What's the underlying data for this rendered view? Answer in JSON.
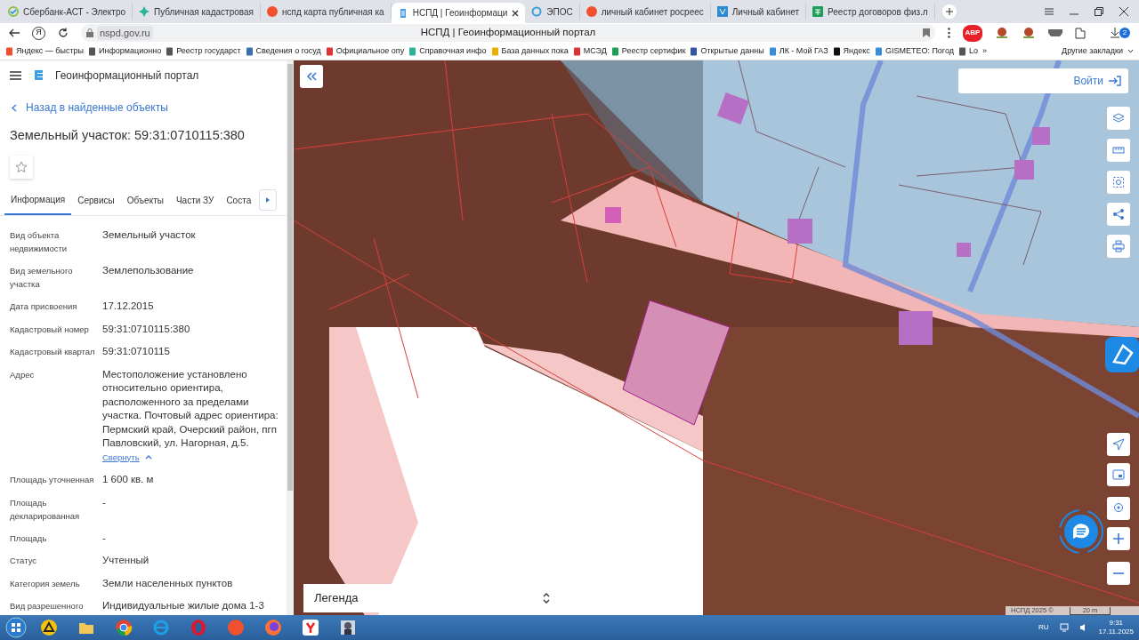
{
  "browser": {
    "tabs": [
      {
        "title": "Сбербанк-АСТ - Электро",
        "selected": false
      },
      {
        "title": "Публичная кадастровая",
        "selected": false
      },
      {
        "title": "нспд карта публичная ка",
        "selected": false
      },
      {
        "title": "НСПД | Геоинформаци",
        "selected": true
      },
      {
        "title": "ЭПОС",
        "selected": false
      },
      {
        "title": "личный кабинет росреес",
        "selected": false
      },
      {
        "title": "Личный кабинет",
        "selected": false
      },
      {
        "title": "Реестр договоров физ.л",
        "selected": false
      }
    ],
    "home_label": "Я",
    "address": "nspd.gov.ru",
    "page_title": "НСПД | Геоинформационный портал",
    "adblock_label": "ABP",
    "downloads_count": "2",
    "bookmarks": [
      "Яндекс — быстры",
      "Информационно",
      "Реестр государст",
      "Сведения о госуд",
      "Официальное опу",
      "Справочная инфо",
      "База данных пока",
      "МСЭД",
      "Реестр сертифик",
      "Открытые данны",
      "ЛК - Мой ГАЗ",
      "Яндекс",
      "GISMETEO: Погод",
      "Lo"
    ],
    "more_bookmarks": "»",
    "other_bookmarks": "Другие закладки"
  },
  "portal": {
    "title": "Геоинформационный портал",
    "back_link": "Назад в найденные объекты",
    "heading": "Земельный участок: 59:31:0710115:380",
    "tabs": [
      {
        "label": "Информация",
        "selected": true
      },
      {
        "label": "Сервисы",
        "selected": false
      },
      {
        "label": "Объекты",
        "selected": false
      },
      {
        "label": "Части ЗУ",
        "selected": false
      },
      {
        "label": "Соста",
        "selected": false
      }
    ],
    "fields": [
      {
        "label": "Вид объекта недвижимости",
        "value": "Земельный участок"
      },
      {
        "label": "Вид земельного участка",
        "value": "Землепользование"
      },
      {
        "label": "Дата присвоения",
        "value": "17.12.2015"
      },
      {
        "label": "Кадастровый номер",
        "value": "59:31:0710115:380"
      },
      {
        "label": "Кадастровый квартал",
        "value": "59:31:0710115"
      },
      {
        "label": "Адрес",
        "value": "Местоположение установлено относительно ориентира, расположенного за пределами участка. Почтовый адрес ориентира: Пермский край, Очерский район, пгп Павловский, ул. Нагорная, д.5.",
        "toggle": "Свернуть"
      },
      {
        "label": "Площадь уточненная",
        "value": "1 600 кв. м"
      },
      {
        "label": "Площадь декларированная",
        "value": "-"
      },
      {
        "label": "Площадь",
        "value": "-"
      },
      {
        "label": "Статус",
        "value": "Учтенный"
      },
      {
        "label": "Категория земель",
        "value": "Земли населенных пунктов"
      },
      {
        "label": "Вид разрешенного",
        "value": "Индивидуальные жилые дома 1-3"
      }
    ]
  },
  "map": {
    "login": "Войти",
    "legend": "Легенда",
    "attribution": "НСПД 2025 ©",
    "scale": "20 m"
  },
  "taskbar": {
    "language": "RU",
    "time": "9:31",
    "date": "17.11.2025"
  }
}
